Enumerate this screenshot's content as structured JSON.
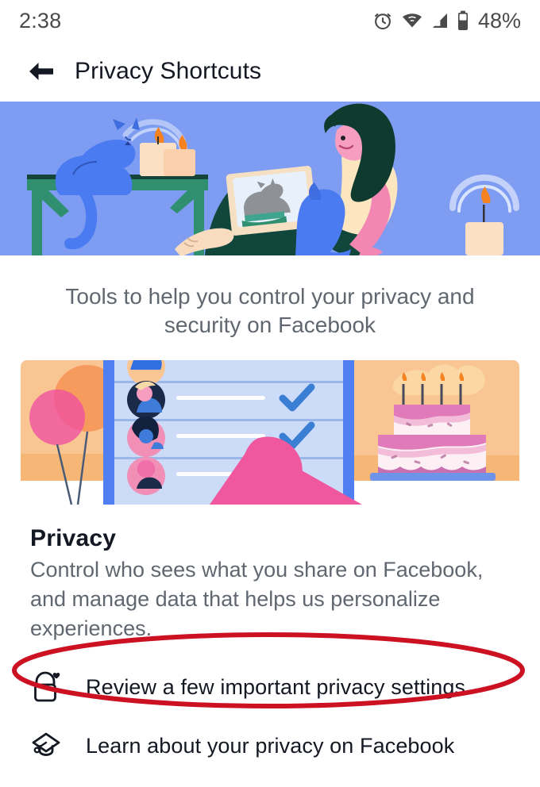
{
  "status_bar": {
    "time": "2:38",
    "battery_percent": "48%",
    "icons": [
      "alarm-clock-icon",
      "wifi-icon",
      "cellular-signal-icon",
      "battery-icon"
    ]
  },
  "app_bar": {
    "back_icon": "back-arrow-icon",
    "title": "Privacy Shortcuts"
  },
  "hero": {
    "illustration_name": "person-reading-with-pets-illustration",
    "background_color": "#7d9cf2",
    "elements": [
      "blue-cat",
      "green-table",
      "two-candles",
      "person-with-tablet",
      "blue-dog",
      "candle-with-glow"
    ]
  },
  "intro": {
    "text": "Tools to help you control your privacy and security on Facebook"
  },
  "privacy_card": {
    "illustration_name": "privacy-checkup-illustration",
    "elements": [
      "balloons-card",
      "friends-list-panel",
      "blue-checkmarks",
      "pink-pointing-hand",
      "birthday-cake-card"
    ],
    "colors": {
      "peach": "#f9c693",
      "panel_blue": "#ccdcf8",
      "accent_blue": "#4f7ff0",
      "pink": "#ef579f",
      "check_blue": "#3b7fd4"
    }
  },
  "section": {
    "title": "Privacy",
    "description": "Control who sees what you share on Facebook, and manage data that helps us personalize experiences."
  },
  "list": {
    "items": [
      {
        "icon": "lock-heart-icon",
        "label": "Review a few important privacy settings"
      },
      {
        "icon": "graduation-cap-icon",
        "label": "Learn about your privacy on Facebook"
      }
    ]
  },
  "annotation": {
    "shape": "ellipse",
    "color": "#cc1122",
    "targets_label": "Review a few important privacy settings"
  }
}
